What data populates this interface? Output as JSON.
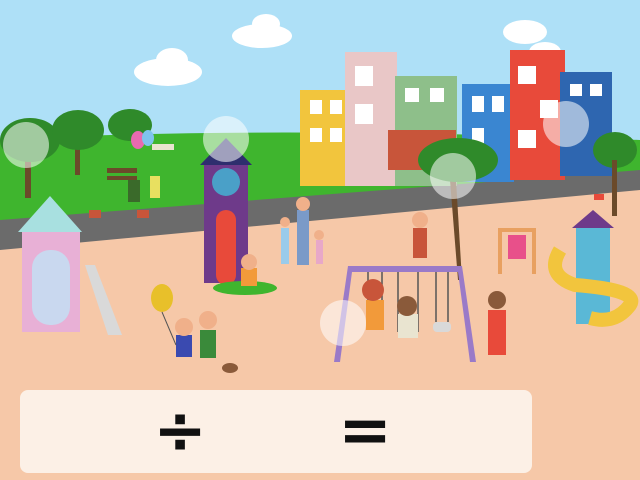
{
  "game": {
    "scene": "playground",
    "equation": {
      "operator": "÷",
      "equals": "="
    },
    "hint_count": 6
  },
  "colors": {
    "sky": "#aee0f7",
    "grass": "#3fb52e",
    "road": "#6b6b6b",
    "ground": "#f6c8a8",
    "panel": "#fcf0e6"
  }
}
